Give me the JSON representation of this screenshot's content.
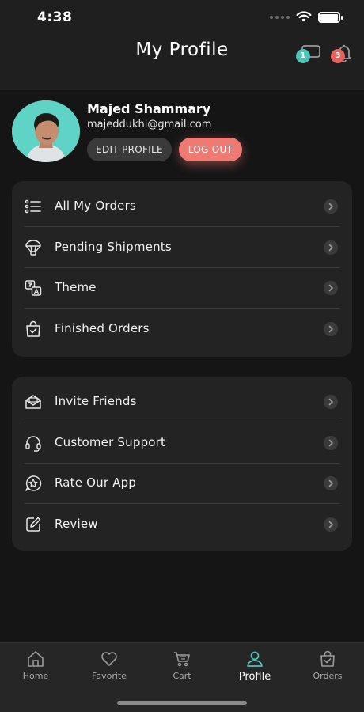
{
  "status_bar": {
    "time": "4:38"
  },
  "header": {
    "title": "My Profile",
    "chat_badge": "1",
    "notification_badge": "3",
    "chat_icon": "chat-bubble-icon",
    "notification_icon": "bell-icon"
  },
  "profile": {
    "name": "Majed Shammary",
    "email": "majeddukhi@gmail.com",
    "edit_label": "EDIT PROFILE",
    "logout_label": "LOG OUT"
  },
  "menu_group_1": [
    {
      "label": "All My Orders",
      "icon": "list-icon"
    },
    {
      "label": "Pending Shipments",
      "icon": "parachute-icon"
    },
    {
      "label": "Theme",
      "icon": "translate-icon"
    },
    {
      "label": "Finished Orders",
      "icon": "shopping-bag-check-icon"
    }
  ],
  "menu_group_2": [
    {
      "label": "Invite Friends",
      "icon": "envelope-icon"
    },
    {
      "label": "Customer Support",
      "icon": "headset-icon"
    },
    {
      "label": "Rate Our App",
      "icon": "star-badge-icon"
    },
    {
      "label": "Review",
      "icon": "edit-icon"
    }
  ],
  "tabbar": [
    {
      "label": "Home",
      "icon": "home-icon",
      "active": false
    },
    {
      "label": "Favorite",
      "icon": "heart-icon",
      "active": false
    },
    {
      "label": "Cart",
      "icon": "cart-icon",
      "active": false
    },
    {
      "label": "Profile",
      "icon": "user-icon",
      "active": true
    },
    {
      "label": "Orders",
      "icon": "orders-bag-icon",
      "active": false
    }
  ],
  "colors": {
    "accent_teal": "#4fc3b5",
    "accent_red": "#e8615c",
    "logout_button": "#ef7a72",
    "background": "#151516",
    "card": "#232324"
  }
}
